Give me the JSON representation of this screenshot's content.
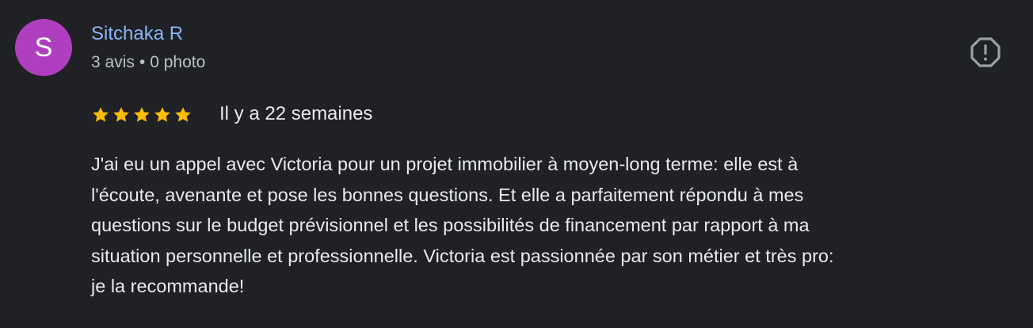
{
  "reviewer": {
    "avatar_letter": "S",
    "avatar_color": "#b03fbf",
    "name": "Sitchaka R",
    "reviews_count": "3 avis",
    "separator": "•",
    "photos_count": "0 photo"
  },
  "report": {
    "icon": "report-octagon-icon"
  },
  "review": {
    "rating": 5,
    "max_rating": 5,
    "star_color": "#fbbc04",
    "date": "Il y a 22 semaines",
    "text": "J'ai eu un appel avec Victoria pour un projet immobilier à moyen-long terme: elle est à\nl'écoute, avenante et pose les bonnes questions. Et elle a parfaitement répondu à mes\nquestions sur le budget prévisionnel et les possibilités de financement par rapport à ma\nsituation personnelle et professionnelle. Victoria est passionnée par son métier et très pro:\nje la recommande!"
  }
}
